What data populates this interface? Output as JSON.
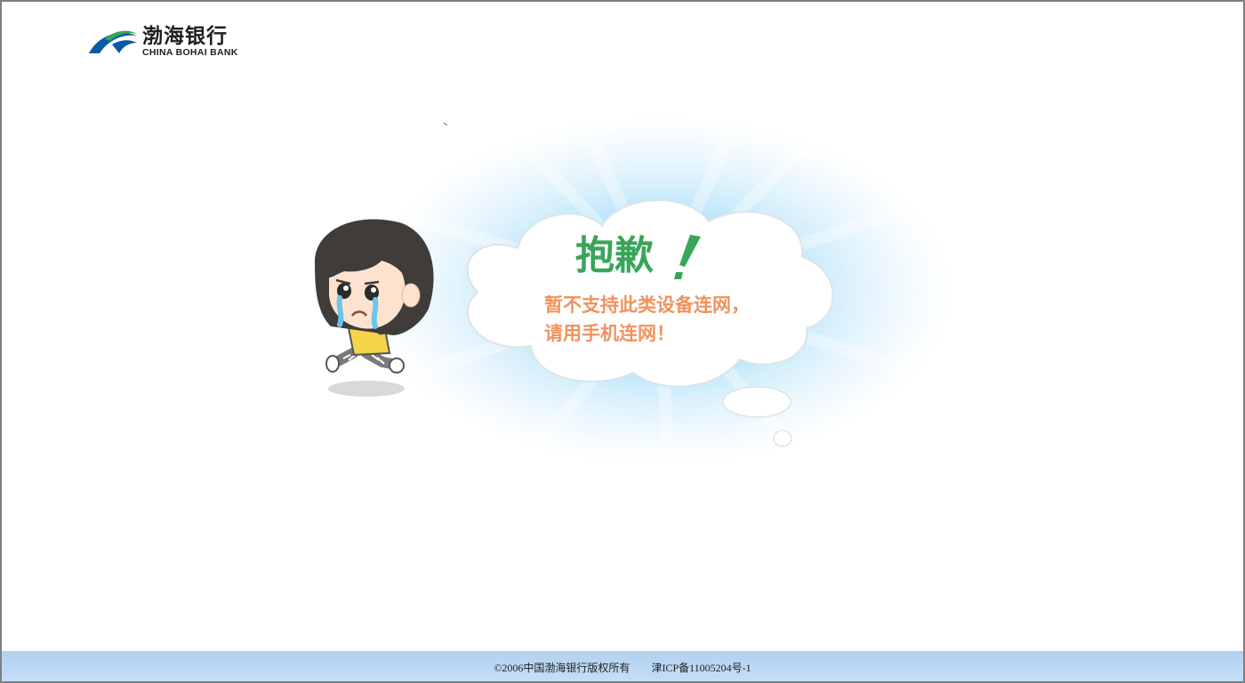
{
  "logo": {
    "name_cn": "渤海银行",
    "name_en": "CHINA BOHAI BANK",
    "colors": {
      "blue": "#0b5aa6",
      "green": "#3aa55a"
    }
  },
  "message": {
    "title": "抱歉",
    "line1": "暂不支持此类设备连网，",
    "line2": "请用手机连网！",
    "title_color": "#3aa55a",
    "text_color": "#f0925e"
  },
  "illustration": {
    "character": "crying-boy-icon",
    "bubble": "thought-cloud-icon"
  },
  "footer": {
    "copyright": "©2006中国渤海银行版权所有",
    "icp": "津ICP备11005204号-1",
    "background": "#b9d6f2"
  }
}
